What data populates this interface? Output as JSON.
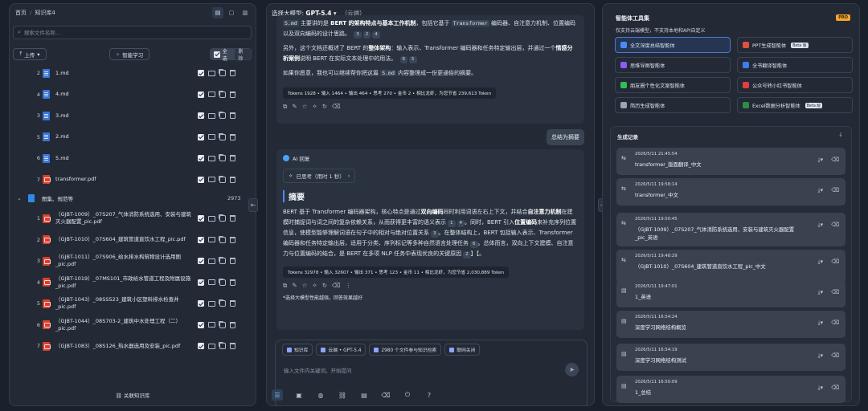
{
  "left": {
    "breadcrumb": {
      "root": "首页",
      "current": "知识库4"
    },
    "search_placeholder": "搜索文件名称...",
    "upload_label": "上传",
    "smart_label": "智能学习",
    "select_all": "全选",
    "delete": "删除",
    "files": [
      {
        "num": "2",
        "type": "md",
        "name": "1.md"
      },
      {
        "num": "4",
        "type": "md",
        "name": "4.md"
      },
      {
        "num": "3",
        "type": "md",
        "name": "3.md"
      },
      {
        "num": "5",
        "type": "md",
        "name": "2.md"
      },
      {
        "num": "6",
        "type": "md",
        "name": "5.md"
      },
      {
        "num": "7",
        "type": "pdf",
        "name": "transformer.pdf"
      }
    ],
    "group": {
      "name": "图集、规范等",
      "count": "2973"
    },
    "group_files": [
      {
        "num": "1",
        "name": "（GJBT-1009）_07S207_气体消防系统选用、安装与建筑灭火器配置_pic.pdf"
      },
      {
        "num": "2",
        "name": "（GJBT-1010）_07S604_建筑管道直饮水工程_pic.pdf"
      },
      {
        "num": "3",
        "name": "（GJBT-1011）_07S906_给水排水构筑物设计选用图_pic.pdf"
      },
      {
        "num": "4",
        "name": "（GJBT-1019）_07MS101_市政给水管道工程及附属设施_pic.pdf"
      },
      {
        "num": "5",
        "name": "（GJBT-1043）_08SS523_建筑小区塑料排水检查井_pic.pdf"
      },
      {
        "num": "6",
        "name": "（GJBT-1044）_08S703-2_建筑中水处理工程（二）_pic.pdf"
      },
      {
        "num": "7",
        "name": "（GJBT-1083）_08S126_热水器选用及安装_pic.pdf"
      }
    ],
    "assoc_label": "关联知识库"
  },
  "mid": {
    "model_label": "选择大模型:",
    "model_name": "GPT-5.4",
    "model_loc": "（云端）",
    "msg1": {
      "p1a": "主要讲的是",
      "p1b": "BERT 的架构特点与基本工作机制",
      "p1c": "，包括它基于",
      "p1d": "编码器、自注意力机制、位置编码以及双向编码的设计思路。",
      "code1": "S.md",
      "code2": "Transformer",
      "refs1": [
        "3",
        "2",
        "4"
      ],
      "p2a": "另外，这个文档还概述了 BERT 的",
      "p2b": "整体架构",
      "p2c": "：输入表示、Transformer 编码器和任务特定输出层，并通过一个",
      "p2d": "情感分析案例",
      "p2e": "说明 BERT 在实际文本处理中的用法。",
      "refs2": [
        "6",
        "5"
      ],
      "p3a": "如果你愿意，我也可以继续帮你把这篇",
      "p3b": "内容整理成一份更通俗的摘要。",
      "code3": "S.md",
      "tokens": "Tokens 1928 • 输入 1464 • 输出 464 • 思考 270 • 金币 2 • 相比龙虾，为您节省 239,613 Token"
    },
    "user_msg": "总结为摘要",
    "ai_label": "AI 回复",
    "think_label": "已思考（用时 1 秒）",
    "summary_title": "摘要",
    "summary": {
      "s1": "BERT 基于 Transformer 编码器架构，核心特点是通过",
      "s2": "双向编码",
      "s3": "同时利用词语左右上下文，并结合",
      "s4": "自注意力机制",
      "s5": "在建模时捕捉词与词之间的复杂依赖关系，从而获得更丰富的语义表示",
      "r1": [
        "1",
        "4"
      ],
      "s6": "。同时，BERT 引入",
      "s7": "位置编码",
      "s8": "来补充序列位置信息，使模型能够理解词语在句子中的相对与绝对位置关系",
      "r2": [
        "3"
      ],
      "s9": "。在整体结构上，BERT 包括输入表示、Transformer 编码器和任务特定输出层，适用于分类、序列标记等多种自然语言处理任务",
      "r3": [
        "6"
      ],
      "s10": "。总体而言，双向上下文建模、自注意力与位置编码的结合，是 BERT 在多项 NLP 任务中表现优良的关键原因",
      "r4": [
        "2"
      ],
      "s11": "】【。"
    },
    "tokens2": "Tokens 32978 • 输入 32607 • 输出 371 • 思考 123 • 金币 11 • 相比龙虾，为您节省 2,030,889 Token",
    "warn": "*选择大模型性能越强，回答效果越好",
    "chips": [
      "知识库",
      "云端 • GPT-5.4",
      "2980 个文件参与知识检索",
      "联网关闭"
    ],
    "input_placeholder": "输入文件内关键词，开始提问"
  },
  "right": {
    "title": "智能体工具集",
    "badge": "PRO",
    "subtitle": "仅支持云端模型，不支持本地和API自定义",
    "agents": [
      {
        "name": "全文深度总结智能体",
        "color": "#4a8cf5",
        "beta": "",
        "sel": true
      },
      {
        "name": "PPT生成智能体",
        "color": "#e0523a",
        "beta": "Beta 版",
        "sel": false
      },
      {
        "name": "思维导图智能体",
        "color": "#8b5cf6",
        "beta": "",
        "sel": false
      },
      {
        "name": "全书翻译智能体",
        "color": "#3d7cf0",
        "beta": "",
        "sel": false
      },
      {
        "name": "朋友圈个性化文案智能体",
        "color": "#2fbf5a",
        "beta": "",
        "sel": false
      },
      {
        "name": "公众号转小红书智能体",
        "color": "#e33d3d",
        "beta": "",
        "sel": false
      },
      {
        "name": "简历生成智能体",
        "color": "#9aa5b6",
        "beta": "",
        "sel": false
      },
      {
        "name": "Excel数据分析智能体",
        "color": "#2e8b4a",
        "beta": "Beta 版",
        "sel": false
      }
    ],
    "history_title": "生成记录",
    "history": [
      {
        "date": "2026/5/11 21:45:54",
        "name": "transformer_版面翻译_中文"
      },
      {
        "date": "2026/5/11 19:58:14",
        "name": "transformer_中文"
      },
      {
        "date": "2026/5/11 19:50:45",
        "name": "（GJBT-1009）_07S207_气体消防系统选用、安装与建筑灭火器配置_pic_英语"
      },
      {
        "date": "2026/5/11 19:48:29",
        "name": "（GJBT-1010）_07S604_建筑管道直饮水工程_pic_中文"
      },
      {
        "date": "2026/5/11 19:47:01",
        "name": "1_英语"
      },
      {
        "date": "2026/5/11 16:54:24",
        "name": "深度学习网络结构概览"
      },
      {
        "date": "2026/5/11 16:54:19",
        "name": "深度学习网络结构测试"
      },
      {
        "date": "2026/5/11 16:50:09",
        "name": "1_总结"
      }
    ]
  }
}
